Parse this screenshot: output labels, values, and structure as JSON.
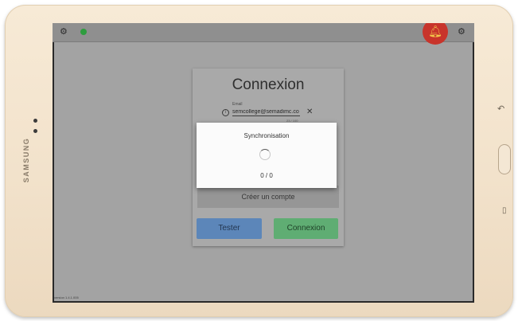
{
  "device": {
    "brand": "SAMSUNG"
  },
  "topbar": {
    "left_icon": "gear-icon",
    "status_icon": "sync-ok-dot",
    "notification_icon": "bell-icon",
    "right_icon": "gear-icon",
    "colors": {
      "status": "#2e9d3e",
      "bell_bg": "#c8342b",
      "bell_fg": "#f2c34a"
    }
  },
  "login": {
    "title": "Connexion",
    "email_label": "Email",
    "email_value": "semcollege@semadimc.co",
    "char_counter": "23 / 100",
    "create_account_label": "Créer un compte",
    "test_label": "Tester",
    "connect_label": "Connexion",
    "colors": {
      "test": "#5c86b9",
      "connect": "#5fad73"
    }
  },
  "sync_dialog": {
    "title": "Synchronisation",
    "progress": "0 / 0"
  },
  "footer": {
    "version": "version 1.4.1.005"
  }
}
